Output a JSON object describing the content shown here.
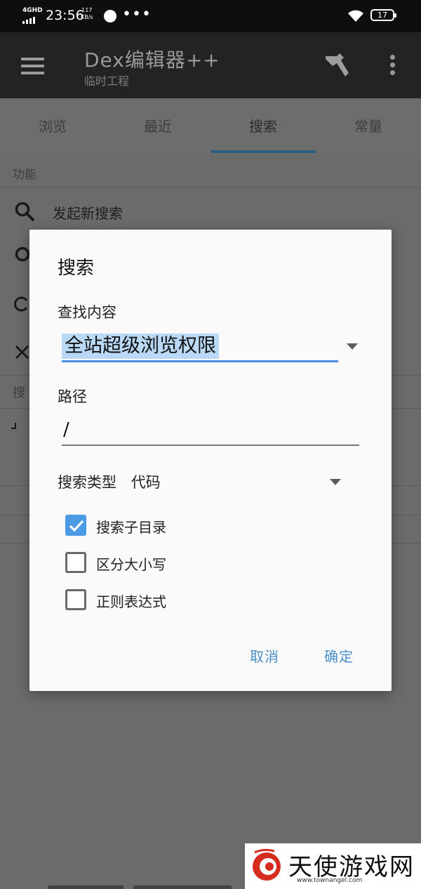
{
  "status_bar": {
    "network": "4GHD",
    "time": "23:56",
    "speed_value": "117",
    "speed_unit": "KB/s",
    "dots": "•••",
    "battery": "17"
  },
  "app_bar": {
    "title": "Dex编辑器++",
    "subtitle": "临时工程"
  },
  "tabs": [
    "浏览",
    "最近",
    "搜索",
    "常量"
  ],
  "active_tab": "搜索",
  "background": {
    "section_label": "功能",
    "items": [
      {
        "label": "发起新搜索",
        "icon": "search-icon"
      }
    ],
    "peek_section": "搜"
  },
  "dialog": {
    "title": "搜索",
    "find_label": "查找内容",
    "find_value": "全站超级浏览权限",
    "path_label": "路径",
    "path_value": "/",
    "type_label": "搜索类型",
    "type_value": "代码",
    "options": [
      {
        "label": "搜索子目录",
        "checked": true
      },
      {
        "label": "区分大小写",
        "checked": false
      },
      {
        "label": "正则表达式",
        "checked": false
      }
    ],
    "cancel": "取消",
    "confirm": "确定"
  },
  "watermark": {
    "text": "天使游戏网",
    "url": "www.townangel.com"
  },
  "colors": {
    "accent": "#4a9ae4",
    "selection": "#b9d9f6",
    "button_text": "#4a8fc7",
    "app_bar": "#232323"
  }
}
